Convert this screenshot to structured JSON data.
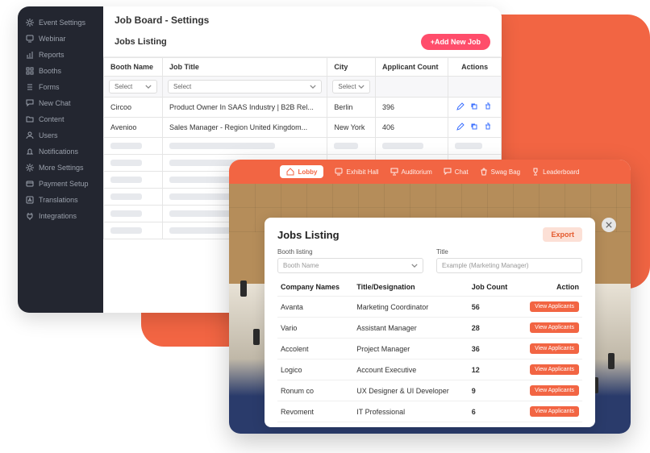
{
  "sidebar": {
    "items": [
      {
        "label": "Event Settings",
        "icon": "gear"
      },
      {
        "label": "Webinar",
        "icon": "screen"
      },
      {
        "label": "Reports",
        "icon": "chart"
      },
      {
        "label": "Booths",
        "icon": "grid"
      },
      {
        "label": "Forms",
        "icon": "list"
      },
      {
        "label": "New Chat",
        "icon": "chat"
      },
      {
        "label": "Content",
        "icon": "folder"
      },
      {
        "label": "Users",
        "icon": "user"
      },
      {
        "label": "Notifications",
        "icon": "bell"
      },
      {
        "label": "More Settings",
        "icon": "gear"
      },
      {
        "label": "Payment Setup",
        "icon": "card"
      },
      {
        "label": "Translations",
        "icon": "lang"
      },
      {
        "label": "Integrations",
        "icon": "plug"
      }
    ]
  },
  "back": {
    "title": "Job Board - Settings",
    "subtitle": "Jobs Listing",
    "add_label": "+Add New Job",
    "columns": [
      "Booth Name",
      "Job Title",
      "City",
      "Applicant Count",
      "Actions"
    ],
    "select_label": "Select",
    "rows": [
      {
        "booth": "Circoo",
        "title": "Product Owner In SAAS Industry | B2B Rel...",
        "city": "Berlin",
        "count": "396"
      },
      {
        "booth": "Avenioo",
        "title": "Sales Manager - Region United Kingdom...",
        "city": "New York",
        "count": "406"
      }
    ]
  },
  "topnav": {
    "items": [
      {
        "label": "Lobby",
        "icon": "home",
        "active": true
      },
      {
        "label": "Exhibit Hall",
        "icon": "screen"
      },
      {
        "label": "Auditorium",
        "icon": "present"
      },
      {
        "label": "Chat",
        "icon": "chat"
      },
      {
        "label": "Swag Bag",
        "icon": "bag"
      },
      {
        "label": "Leaderboard",
        "icon": "trophy"
      }
    ]
  },
  "modal": {
    "title": "Jobs Listing",
    "export": "Export",
    "filters": {
      "booth_label": "Booth listing",
      "booth_placeholder": "Booth Name",
      "title_label": "Title",
      "title_placeholder": "Example (Marketing Manager)"
    },
    "columns": [
      "Company Names",
      "Title/Designation",
      "Job Count",
      "Action"
    ],
    "view_label": "View  Applicants",
    "rows": [
      {
        "company": "Avanta",
        "title": "Marketing Coordinator",
        "count": "56"
      },
      {
        "company": "Vario",
        "title": "Assistant Manager",
        "count": "28"
      },
      {
        "company": "Accolent",
        "title": "Project Manager",
        "count": "36"
      },
      {
        "company": "Logico",
        "title": "Account Executive",
        "count": "12"
      },
      {
        "company": "Ronum co",
        "title": "UX Designer & UI Developer",
        "count": "9"
      },
      {
        "company": "Revoment",
        "title": "IT Professional",
        "count": "6"
      }
    ]
  }
}
